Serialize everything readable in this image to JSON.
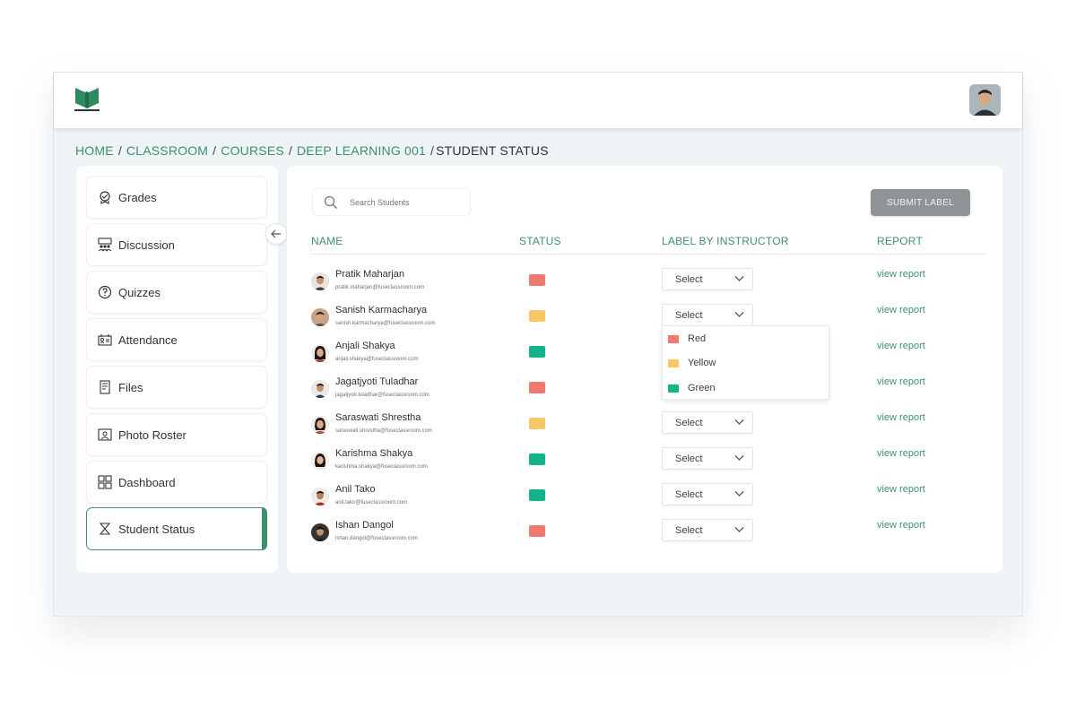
{
  "breadcrumb": [
    "HOME",
    "CLASSROOM",
    "COURSES",
    "DEEP LEARNING 001"
  ],
  "breadcrumb_current": "STUDENT STATUS",
  "sidebar": {
    "items": [
      {
        "label": "Grades",
        "icon": "grades-icon",
        "active": false
      },
      {
        "label": "Discussion",
        "icon": "discussion-icon",
        "active": false
      },
      {
        "label": "Quizzes",
        "icon": "quiz-icon",
        "active": false
      },
      {
        "label": "Attendance",
        "icon": "attendance-icon",
        "active": false
      },
      {
        "label": "Files",
        "icon": "files-icon",
        "active": false
      },
      {
        "label": "Photo Roster",
        "icon": "photo-roster-icon",
        "active": false
      },
      {
        "label": "Dashboard",
        "icon": "dashboard-icon",
        "active": false
      },
      {
        "label": "Student Status",
        "icon": "student-status-icon",
        "active": true
      }
    ]
  },
  "search": {
    "placeholder": "Search Students"
  },
  "submit_label": "SUBMIT LABEL",
  "columns": [
    "NAME",
    "STATUS",
    "LABEL BY INSTRUCTOR",
    "REPORT"
  ],
  "students": [
    {
      "name": "Pratik Maharjan",
      "email": "pratik.maharjan@fuseclassroom.com",
      "status": "red",
      "label": "Select",
      "report": "view report"
    },
    {
      "name": "Sanish Karmacharya",
      "email": "sanish.karmacharya@fuseclassroom.com",
      "status": "yellow",
      "label": "Select",
      "report": "view report"
    },
    {
      "name": "Anjali Shakya",
      "email": "anjali.shakya@fuseclassroom.com",
      "status": "green",
      "label": "",
      "report": "view report"
    },
    {
      "name": "Jagatjyoti Tuladhar",
      "email": "jagatjyoti.tuladhar@fuseclassroom.com",
      "status": "red",
      "label": "",
      "report": "view report"
    },
    {
      "name": "Saraswati Shrestha",
      "email": "saraswati.shrestha@fuseclassroom.com",
      "status": "yellow",
      "label": "Select",
      "report": "view report"
    },
    {
      "name": "Karishma Shakya",
      "email": "karishma.shakya@fuseclassroom.com",
      "status": "green",
      "label": "Select",
      "report": "view report"
    },
    {
      "name": "Anil Tako",
      "email": "anil.tako@fuseclassroom.com",
      "status": "green",
      "label": "Select",
      "report": "view report"
    },
    {
      "name": "Ishan Dangol",
      "email": "ishan.dangol@fuseclassroom.com",
      "status": "red",
      "label": "Select",
      "report": "view report"
    }
  ],
  "dropdown_options": [
    {
      "label": "Red",
      "color": "#f07a70"
    },
    {
      "label": "Yellow",
      "color": "#f7c766"
    },
    {
      "label": "Green",
      "color": "#13b48c"
    }
  ],
  "colors": {
    "accent": "#3f8f6c",
    "red": "#f07a70",
    "yellow": "#f7c766",
    "green": "#13b48c",
    "button_gray": "#8f9597"
  }
}
